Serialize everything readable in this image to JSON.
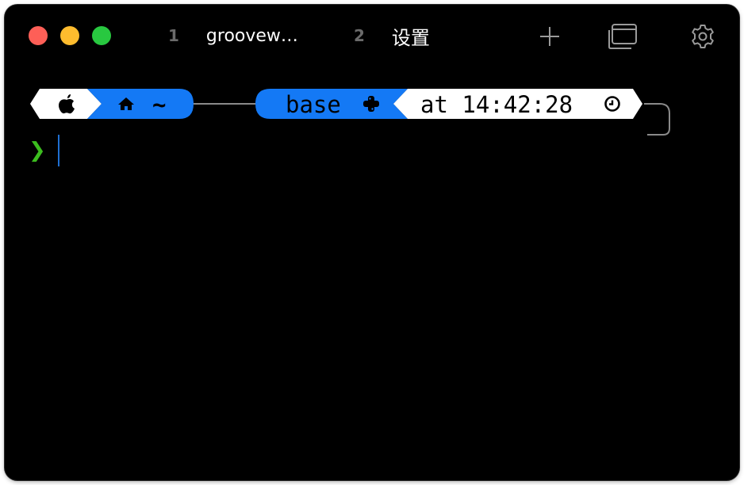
{
  "window": {
    "controls": [
      "close",
      "minimize",
      "zoom"
    ],
    "colors": {
      "close": "#fe5f57",
      "minimize": "#febc2e",
      "zoom": "#28c840"
    }
  },
  "tabs": [
    {
      "number": "1",
      "title": "groovew…"
    },
    {
      "number": "2",
      "title": "设置"
    }
  ],
  "toolbar": {
    "icons": [
      "plus-icon",
      "windows-icon",
      "gear-icon"
    ]
  },
  "prompt": {
    "os_icon": "apple-icon",
    "home_icon": "home-icon",
    "directory": "~",
    "environment": "base",
    "environment_icon": "python-icon",
    "time_text": "at 14:42:28",
    "time_icon": "clock-icon",
    "prompt_char": "❯",
    "colors": {
      "segment_white": "#ffffff",
      "segment_blue": "#1479f5",
      "connector": "#8a8a8a",
      "prompt_char": "#3cbd1f",
      "cursor": "#1f6fd1"
    }
  }
}
